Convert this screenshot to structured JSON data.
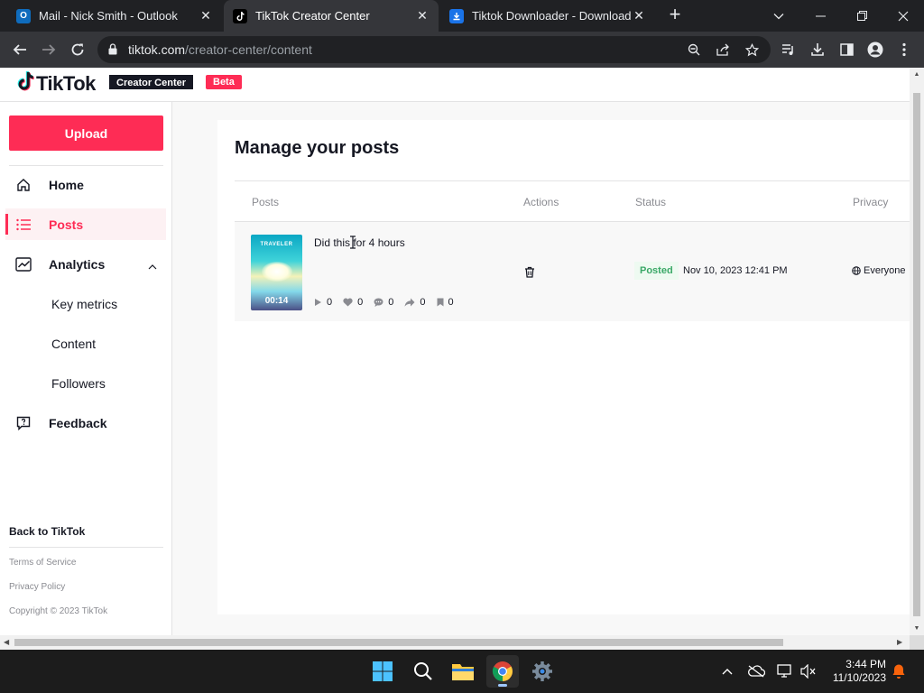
{
  "browser": {
    "tabs": [
      {
        "title": "Mail - Nick Smith - Outlook",
        "active": false,
        "favicon": "outlook-icon"
      },
      {
        "title": "TikTok Creator Center",
        "active": true,
        "favicon": "tiktok-icon"
      },
      {
        "title": "Tiktok Downloader - Download",
        "active": false,
        "favicon": "download-icon"
      }
    ],
    "url_host": "tiktok.com",
    "url_path": "/creator-center/content"
  },
  "header": {
    "logo_text": "TikTok",
    "creator_badge": "Creator Center",
    "beta_badge": "Beta"
  },
  "sidebar": {
    "upload_label": "Upload",
    "items": [
      {
        "label": "Home",
        "icon": "home-icon"
      },
      {
        "label": "Posts",
        "icon": "list-icon",
        "active": true
      },
      {
        "label": "Analytics",
        "icon": "chart-icon",
        "expanded": true
      },
      {
        "label": "Feedback",
        "icon": "feedback-icon"
      }
    ],
    "analytics_sub": [
      "Key metrics",
      "Content",
      "Followers"
    ],
    "back_link": "Back to TikTok",
    "footer_links": [
      "Terms of Service",
      "Privacy Policy",
      "Copyright © 2023 TikTok"
    ]
  },
  "main": {
    "title": "Manage your posts",
    "columns": [
      "Posts",
      "Actions",
      "Status",
      "Privacy"
    ],
    "posts": [
      {
        "title": "Did this for 4 hours",
        "thumbnail_label": "TRAVELER",
        "duration": "00:14",
        "stats": {
          "plays": "0",
          "likes": "0",
          "comments": "0",
          "shares": "0",
          "saves": "0"
        },
        "status": "Posted",
        "date": "Nov 10, 2023 12:41 PM",
        "privacy": "Everyone"
      }
    ]
  },
  "taskbar": {
    "time": "3:44 PM",
    "date": "11/10/2023"
  },
  "colors": {
    "accent": "#fe2c55",
    "status_green": "#3aa867",
    "chrome_dark": "#202124",
    "chrome_toolbar": "#35363a"
  }
}
